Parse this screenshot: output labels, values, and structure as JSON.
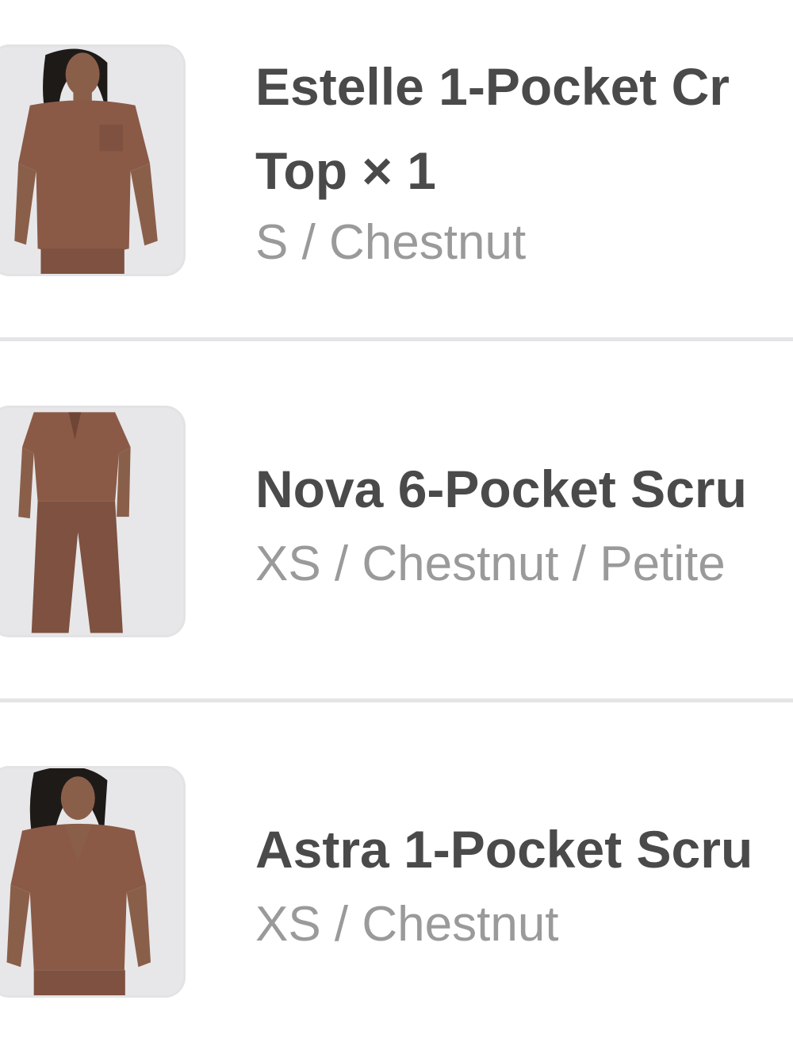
{
  "order_items": [
    {
      "title_line1": "Estelle 1-Pocket Cr",
      "title_line2": "Top × 1",
      "variant": "S / Chestnut",
      "image": "product-photo-top-chestnut"
    },
    {
      "title_line1": "Nova 6-Pocket Scru",
      "variant": "XS / Chestnut / Petite",
      "image": "product-photo-set-chestnut"
    },
    {
      "title_line1": "Astra 1-Pocket Scru",
      "variant": "XS / Chestnut",
      "image": "product-photo-top-chestnut"
    }
  ],
  "colors": {
    "scrub": "#8a5a47",
    "title": "#4a4a4a",
    "variant": "#9a9a9a",
    "divider": "#e4e4e6"
  }
}
